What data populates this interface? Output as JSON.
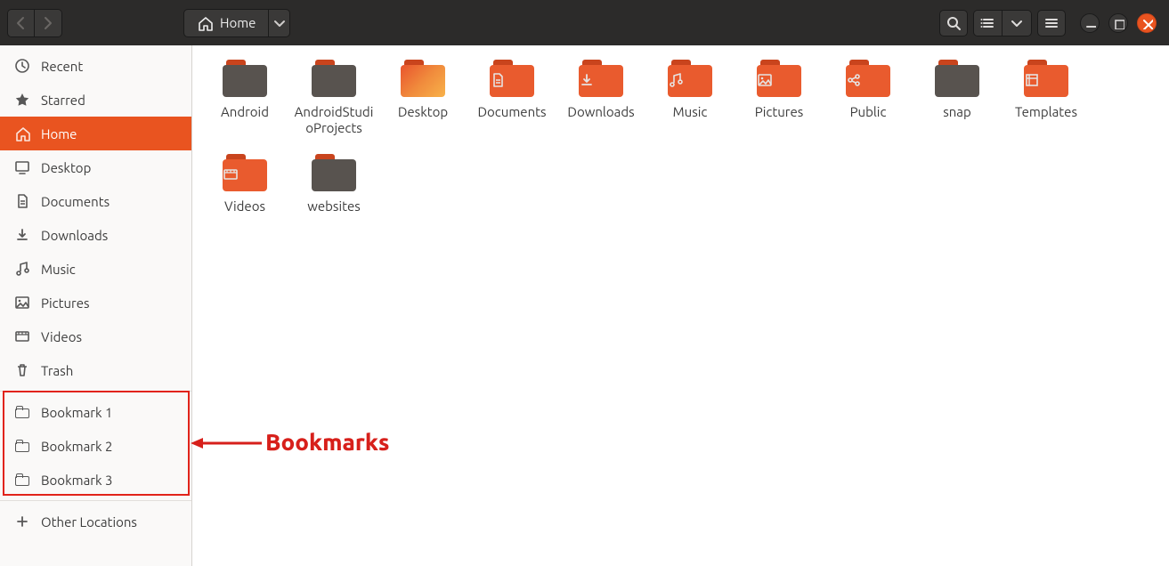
{
  "titlebar": {
    "path_label": "Home"
  },
  "sidebar": {
    "items": [
      {
        "icon": "clock",
        "label": "Recent"
      },
      {
        "icon": "star",
        "label": "Starred"
      },
      {
        "icon": "home",
        "label": "Home",
        "active": true
      },
      {
        "icon": "desktop",
        "label": "Desktop"
      },
      {
        "icon": "doc",
        "label": "Documents"
      },
      {
        "icon": "download",
        "label": "Downloads"
      },
      {
        "icon": "music",
        "label": "Music"
      },
      {
        "icon": "picture",
        "label": "Pictures"
      },
      {
        "icon": "video",
        "label": "Videos"
      },
      {
        "icon": "trash",
        "label": "Trash"
      }
    ],
    "bookmarks": [
      {
        "label": "Bookmark 1"
      },
      {
        "label": "Bookmark 2"
      },
      {
        "label": "Bookmark 3"
      }
    ],
    "other_locations": "Other Locations"
  },
  "files": [
    {
      "name": "Android",
      "style": "plain",
      "glyph": ""
    },
    {
      "name": "AndroidStudioProjects",
      "style": "plain",
      "glyph": ""
    },
    {
      "name": "Desktop",
      "style": "desktop",
      "glyph": ""
    },
    {
      "name": "Documents",
      "style": "accent",
      "glyph": "doc"
    },
    {
      "name": "Downloads",
      "style": "accent",
      "glyph": "download"
    },
    {
      "name": "Music",
      "style": "accent",
      "glyph": "music"
    },
    {
      "name": "Pictures",
      "style": "accent",
      "glyph": "picture"
    },
    {
      "name": "Public",
      "style": "accent",
      "glyph": "share"
    },
    {
      "name": "snap",
      "style": "plain",
      "glyph": ""
    },
    {
      "name": "Templates",
      "style": "accent",
      "glyph": "template"
    },
    {
      "name": "Videos",
      "style": "accent",
      "glyph": "video"
    },
    {
      "name": "websites",
      "style": "plain",
      "glyph": ""
    }
  ],
  "annotation": {
    "label": "Bookmarks"
  }
}
